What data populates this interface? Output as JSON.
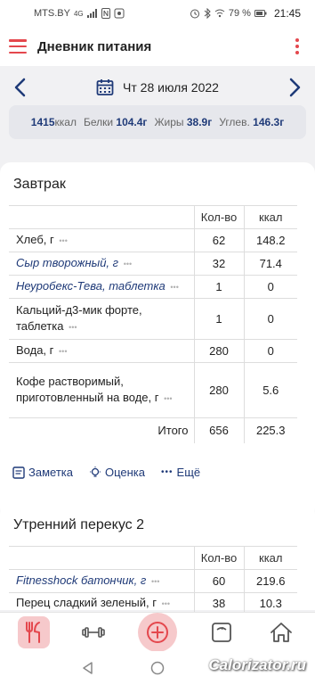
{
  "status": {
    "carrier": "MTS.BY",
    "network": "4G",
    "battery": "79 %",
    "time": "21:45"
  },
  "appbar": {
    "title": "Дневник питания"
  },
  "date": {
    "text": "Чт 28 июля 2022"
  },
  "summary": {
    "kcal": "1415",
    "kcal_unit": "ккал",
    "protein_label": "Белки",
    "protein": "104.4г",
    "fat_label": "Жиры",
    "fat": "38.9г",
    "carbs_label": "Углев.",
    "carbs": "146.3г"
  },
  "breakfast": {
    "title": "Завтрак",
    "col_qty": "Кол-во",
    "col_kcal": "ккал",
    "rows": [
      {
        "name": "Хлеб, г",
        "qty": "62",
        "kcal": "148.2"
      },
      {
        "name": "Сыр творожный, г",
        "qty": "32",
        "kcal": "71.4"
      },
      {
        "name": "Неуробекс-Тева, таблетка",
        "qty": "1",
        "kcal": "0"
      },
      {
        "name": "Кальций-д3-мик форте, таблетка",
        "qty": "1",
        "kcal": "0"
      },
      {
        "name": "Вода, г",
        "qty": "280",
        "kcal": "0"
      },
      {
        "name": "Кофе растворимый, приготовленный на воде, г",
        "qty": "280",
        "kcal": "5.6"
      }
    ],
    "total_label": "Итого",
    "total_qty": "656",
    "total_kcal": "225.3",
    "actions": {
      "note": "Заметка",
      "rating": "Оценка",
      "more": "Ещё"
    }
  },
  "snack": {
    "title": "Утренний перекус 2",
    "col_qty": "Кол-во",
    "col_kcal": "ккал",
    "rows": [
      {
        "name": "Fitnesshock батончик, г",
        "qty": "60",
        "kcal": "219.6"
      },
      {
        "name": "Перец сладкий зеленый, г",
        "qty": "38",
        "kcal": "10.3"
      }
    ]
  },
  "watermark": "Calorizator.ru",
  "colors": {
    "accent": "#e4474d",
    "brand": "#1f3a78",
    "active_bg": "#f6c9cb"
  }
}
